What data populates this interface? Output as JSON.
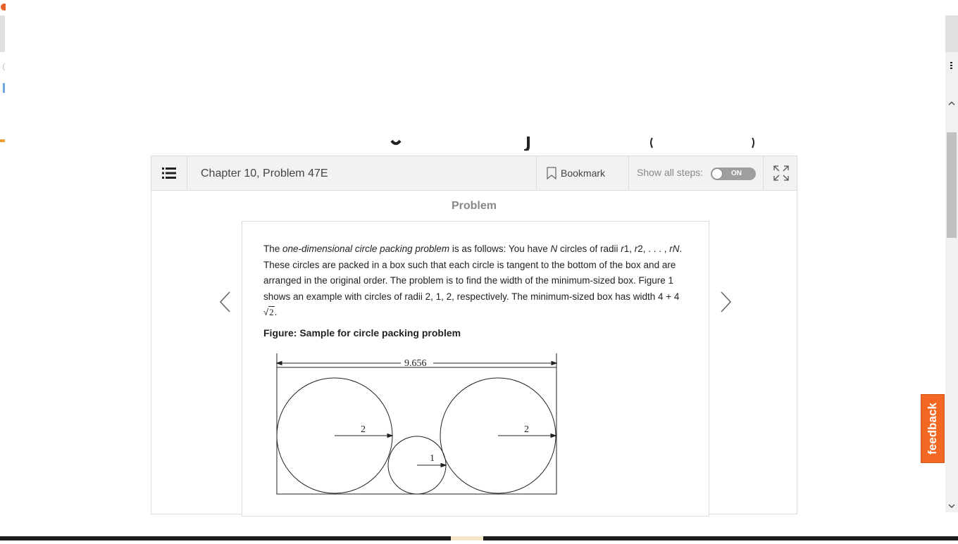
{
  "toolbar": {
    "title": "Chapter 10, Problem 47E",
    "bookmark_label": "Bookmark",
    "show_steps_label": "Show all steps:",
    "toggle_state": "ON"
  },
  "section": {
    "heading": "Problem"
  },
  "problem": {
    "t1": "The ",
    "t2": "one-dimensional circle packing problem",
    "t3": " is as follows: You have ",
    "t4": "N",
    "t5": " circles of radii ",
    "t6": "r",
    "t7": "1, ",
    "t8": "r",
    "t9": "2, . . . , ",
    "t10": "rN",
    "t11": ". These circles are packed in a box such that each circle is tangent to the bottom of the box and are arranged in the original order. The problem is to find the width of the minimum-sized box. Figure 1 shows an example with circles of radii 2, 1, 2, respectively. The minimum-sized box has width 4 + 4 ",
    "sqrt_value": "2",
    "t12": ".",
    "figure_caption": "Figure: Sample for circle packing problem"
  },
  "figure": {
    "width_label": "9.656",
    "radius_left": "2",
    "radius_middle": "1",
    "radius_right": "2"
  },
  "feedback_label": "feedback",
  "colors": {
    "feedback": "#f26722",
    "toolbar_bg": "#f2f2f2",
    "toggle": "#9e9e9e"
  }
}
